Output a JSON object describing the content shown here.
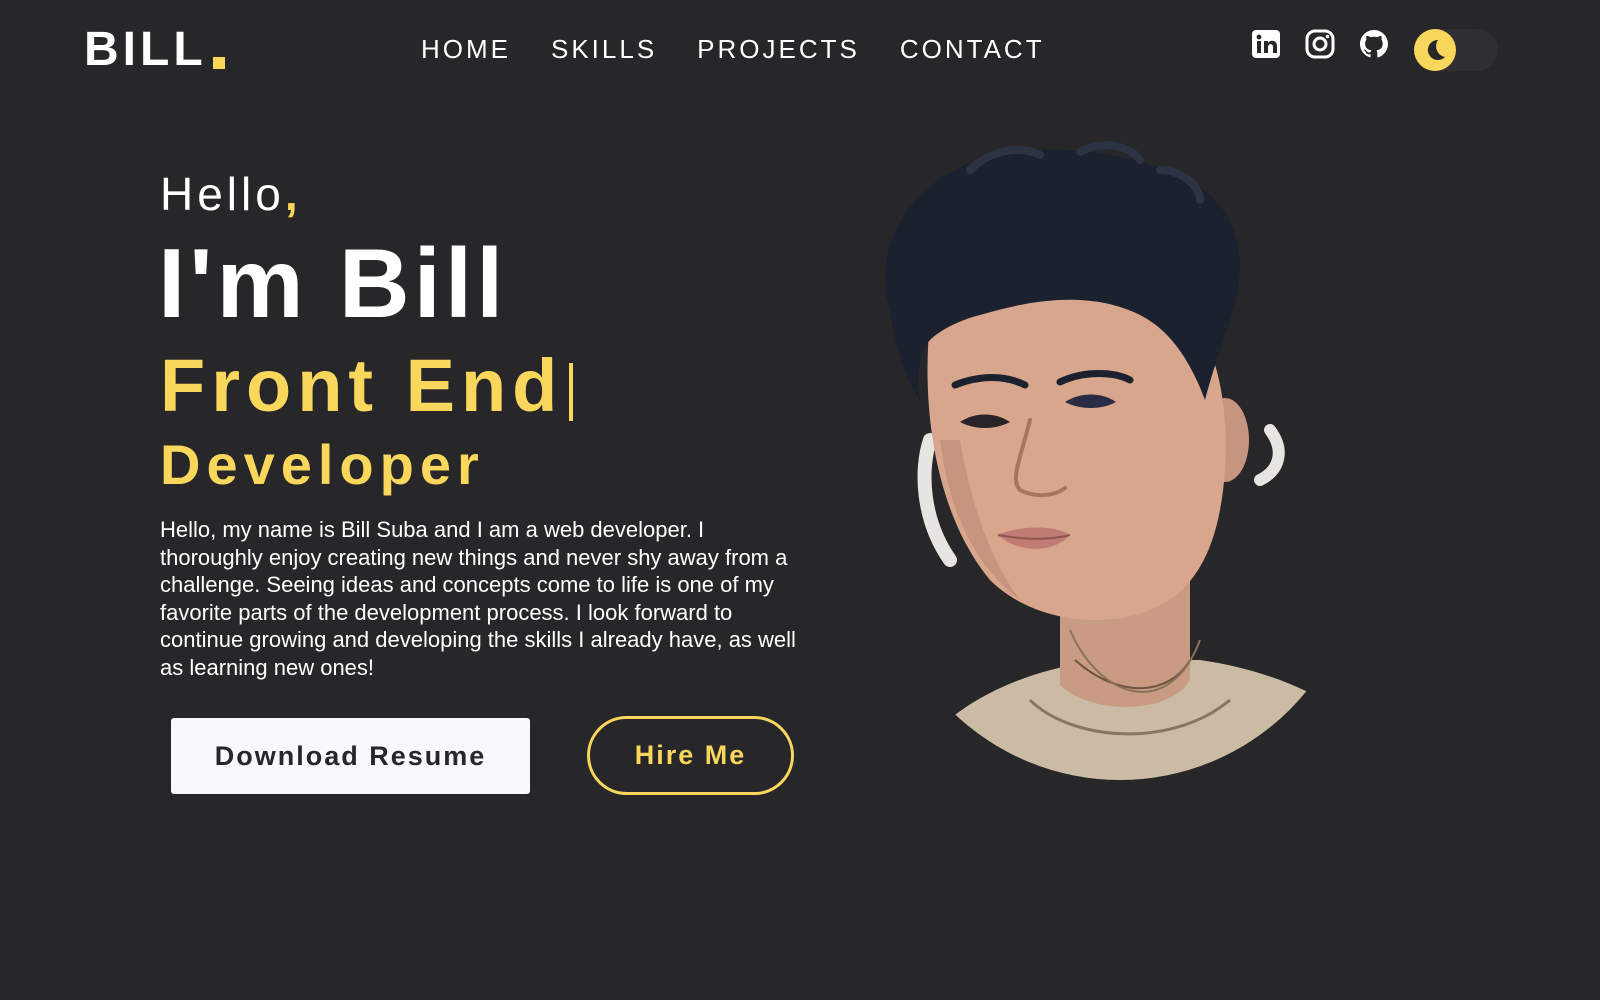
{
  "header": {
    "logo_text": "BILL",
    "nav": [
      {
        "label": "HOME"
      },
      {
        "label": "SKILLS"
      },
      {
        "label": "PROJECTS"
      },
      {
        "label": "CONTACT"
      }
    ],
    "socials": [
      {
        "icon": "linkedin-icon"
      },
      {
        "icon": "instagram-icon"
      },
      {
        "icon": "github-icon"
      }
    ],
    "theme_toggle": {
      "icon": "moon-icon",
      "state": "dark"
    }
  },
  "hero": {
    "greeting": "Hello",
    "greeting_punct": ",",
    "name": "I'm Bill",
    "role_line1": "Front End",
    "role_line2": "Developer",
    "bio": "Hello, my name is Bill Suba and I am a web developer. I thoroughly enjoy creating new things and never shy away from a challenge. Seeing ideas and concepts come to life is one of my favorite parts of the development process. I look forward to continue growing and developing the skills I already have, as well as learning new ones!",
    "download_label": "Download Resume",
    "hire_label": "Hire Me"
  },
  "colors": {
    "background": "#272628",
    "accent": "#f9d65c",
    "text": "#ffffff",
    "button_light": "#f9f8fb"
  }
}
